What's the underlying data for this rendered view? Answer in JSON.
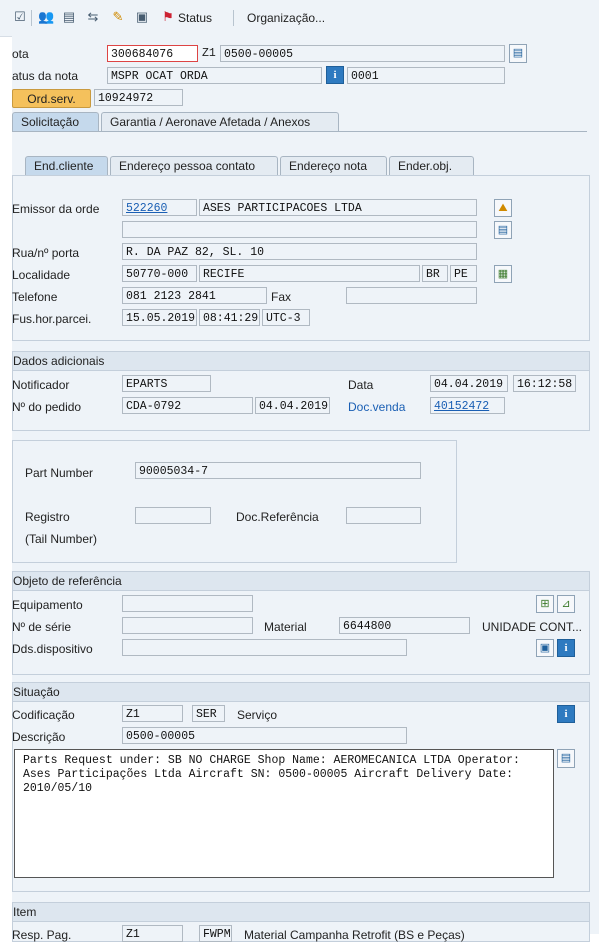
{
  "toolbar": {
    "status_label": "Status",
    "organizacao_label": "Organização..."
  },
  "header": {
    "nota_label": "ota",
    "nota_value": "300684076",
    "nota_type": "Z1",
    "nota_desc": "0500-00005",
    "status_label": "atus da nota",
    "status_value": "MSPR OCAT ORDA",
    "status_code": "0001",
    "ordserv_label": "Ord.serv.",
    "ordserv_value": "10924972"
  },
  "tabs": {
    "solicitacao": "Solicitação",
    "garantia": "Garantia  / Aeronave Afetada / Anexos"
  },
  "subtabs": {
    "end_cliente": "End.cliente",
    "end_pessoa": "Endereço pessoa contato",
    "end_nota": "Endereço nota",
    "ender_obj": "Ender.obj."
  },
  "cliente": {
    "emissor_label": "Emissor da orde",
    "emissor_code": "522260",
    "emissor_name": "ASES PARTICIPACOES LTDA",
    "rua_label": "Rua/nº porta",
    "rua_value": "R. DA PAZ 82, SL. 10",
    "localidade_label": "Localidade",
    "cep": "50770-000",
    "cidade": "RECIFE",
    "pais": "BR",
    "uf": "PE",
    "telefone_label": "Telefone",
    "telefone_value": "081 2123 2841",
    "fax_label": "Fax",
    "fus_label": "Fus.hor.parcei.",
    "fus_date": "15.05.2019",
    "fus_time": "08:41:29",
    "fus_tz": "UTC-3"
  },
  "dados": {
    "title": "Dados adicionais",
    "notificador_label": "Notificador",
    "notificador_value": "EPARTS",
    "data_label": "Data",
    "data_value": "04.04.2019",
    "hora_value": "16:12:58",
    "pedido_label": "Nº do pedido",
    "pedido_value": "CDA-0792",
    "pedido_date": "04.04.2019",
    "docvenda_label": "Doc.venda",
    "docvenda_value": "40152472"
  },
  "part": {
    "part_number_label": "Part Number",
    "part_number_value": "90005034-7",
    "registro_label": "Registro",
    "docref_label": "Doc.Referência",
    "tail_label": "(Tail Number)"
  },
  "objeto": {
    "title": "Objeto de referência",
    "equipamento_label": "Equipamento",
    "serie_label": "Nº de série",
    "material_label": "Material",
    "material_value": "6644800",
    "material_desc": "UNIDADE CONT...",
    "dds_label": "Dds.dispositivo"
  },
  "situacao": {
    "title": "Situação",
    "codificacao_label": "Codificação",
    "codificacao_value": "Z1",
    "cod_code": "SER",
    "cod_desc": "Serviço",
    "descricao_label": "Descrição",
    "descricao_value": "0500-00005",
    "long_text": "Parts Request under: SB NO CHARGE Shop Name: AEROMECANICA LTDA Operator: Ases Participações Ltda Aircraft SN: 0500-00005 Aircraft Delivery Date: 2010/05/10"
  },
  "item": {
    "title": "Item",
    "resp_label": "Resp. Pag.",
    "resp_value": "Z1",
    "resp_code": "FWPM",
    "resp_desc": "Material Campanha Retrofit (BS e Peças)"
  }
}
